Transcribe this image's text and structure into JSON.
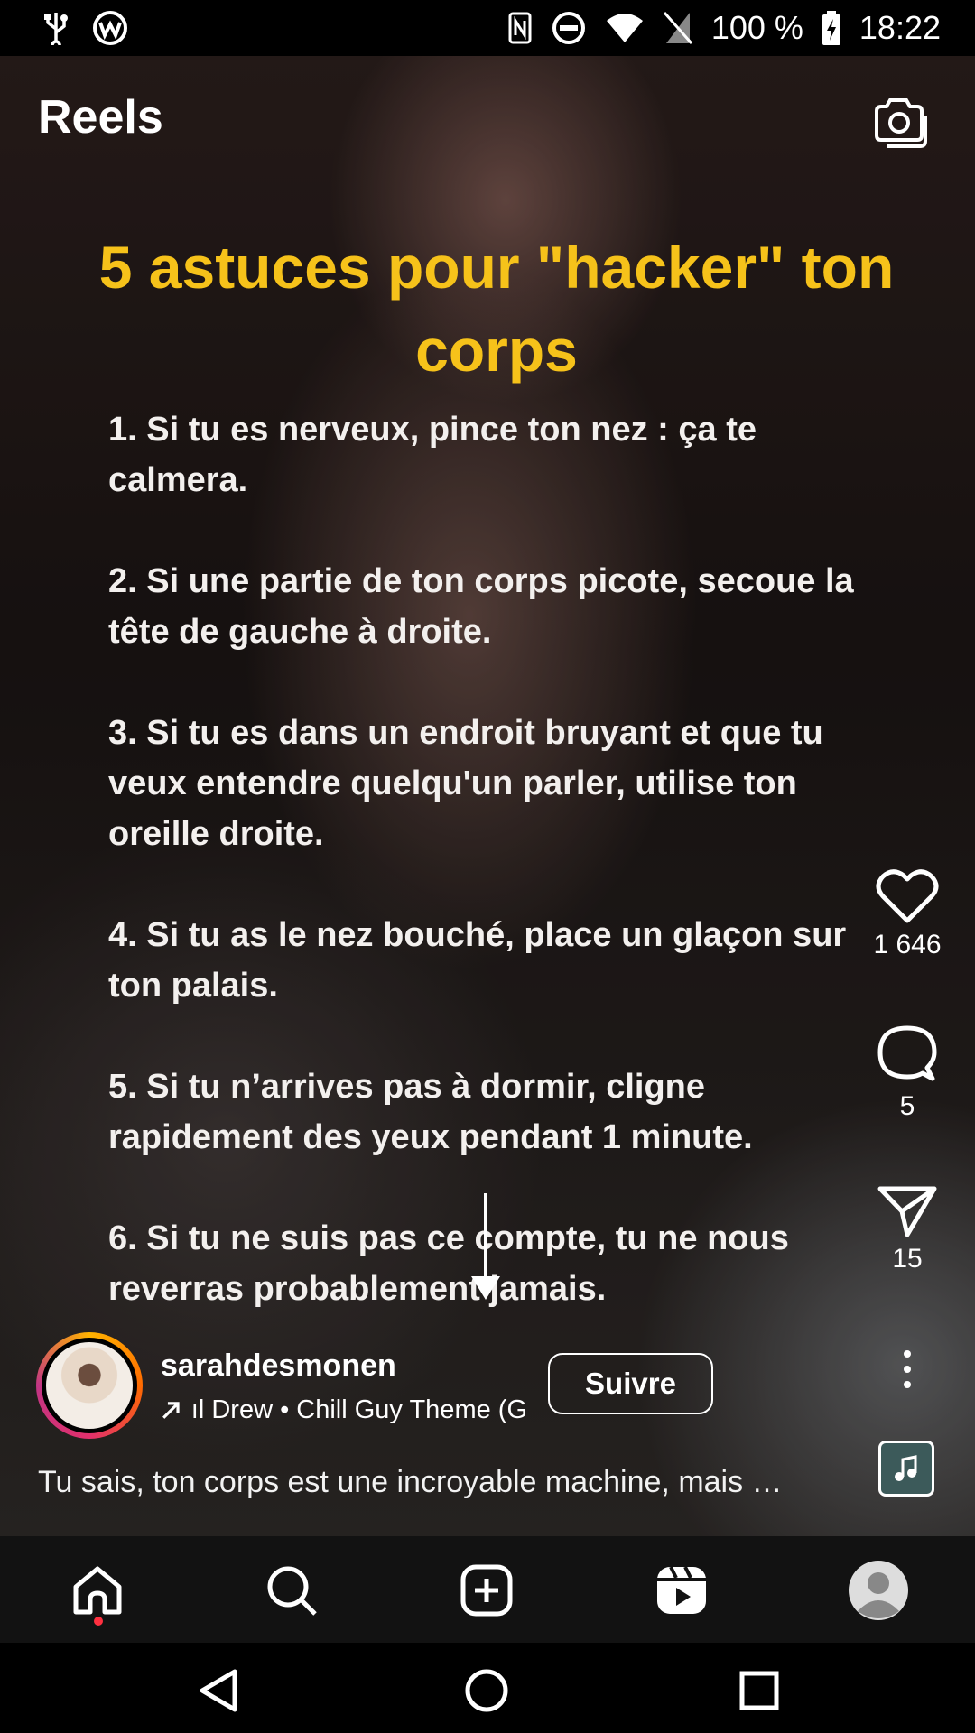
{
  "status_bar": {
    "battery": "100 %",
    "time": "18:22",
    "icons": [
      "usb-icon",
      "vpn-icon",
      "nfc-icon",
      "do-not-disturb-icon",
      "wifi-icon",
      "no-sim-icon",
      "battery-charging-icon"
    ]
  },
  "header": {
    "title": "Reels",
    "camera_icon": "camera-icon"
  },
  "video": {
    "overlay_title": "5 astuces pour \"hacker\" ton corps",
    "tips": [
      "1. Si tu es nerveux, pince ton nez : ça te calmera.",
      "2. Si une partie de ton corps picote, secoue la tête de gauche à droite.",
      "3. Si tu es dans un endroit bruyant et que tu veux entendre quelqu'un parler, utilise ton oreille droite.",
      "4. Si tu as le nez bouché, place un glaçon sur ton palais.",
      "5. Si tu n’arrives pas à dormir, cligne rapidement des yeux pendant 1 minute.",
      "6. Si tu ne suis pas ce compte, tu ne nous reverras probablement jamais."
    ]
  },
  "actions": {
    "likes": "1 646",
    "comments": "5",
    "shares": "15"
  },
  "author": {
    "username": "sarahdesmonen",
    "music": "ıl Drew • Chill Guy Theme (G",
    "follow_label": "Suivre"
  },
  "caption": "Tu sais, ton corps est une incroyable machine, mais …",
  "bottom_nav": [
    "home-icon",
    "search-icon",
    "create-icon",
    "reels-icon",
    "profile-icon"
  ],
  "colors": {
    "overlay_title": "#f6c21a",
    "notification_dot": "#ff3040",
    "nav_background": "#121212"
  }
}
